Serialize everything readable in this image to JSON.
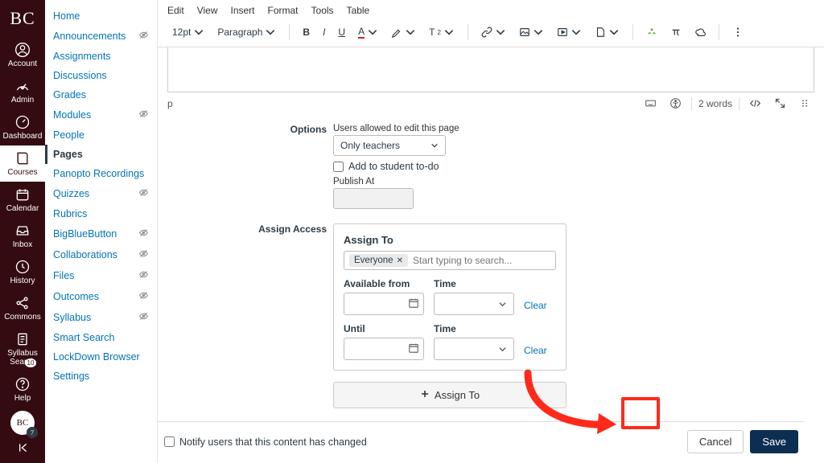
{
  "colors": {
    "brand": "#330b10",
    "primary_btn": "#0b2e52",
    "link": "#0374b5",
    "callout": "#ff2a1a"
  },
  "global_nav": {
    "logo": "BC",
    "items": [
      {
        "key": "account",
        "label": "Account",
        "icon": "user-circle-icon"
      },
      {
        "key": "admin",
        "label": "Admin",
        "icon": "speedometer-icon"
      },
      {
        "key": "dashboard",
        "label": "Dashboard",
        "icon": "gauge-icon"
      },
      {
        "key": "courses",
        "label": "Courses",
        "icon": "book-icon",
        "active": true
      },
      {
        "key": "calendar",
        "label": "Calendar",
        "icon": "calendar-icon"
      },
      {
        "key": "inbox",
        "label": "Inbox",
        "icon": "inbox-icon"
      },
      {
        "key": "history",
        "label": "History",
        "icon": "clock-icon"
      },
      {
        "key": "commons",
        "label": "Commons",
        "icon": "share-icon"
      },
      {
        "key": "syllabus",
        "label": "Syllabus Search",
        "icon": "syllabus-icon"
      },
      {
        "key": "help",
        "label": "Help",
        "icon": "help-icon",
        "badge": "10"
      }
    ],
    "avatar_text": "BC",
    "avatar_count": "7"
  },
  "course_nav": {
    "items": [
      {
        "label": "Home"
      },
      {
        "label": "Announcements",
        "hidden": true
      },
      {
        "label": "Assignments"
      },
      {
        "label": "Discussions"
      },
      {
        "label": "Grades"
      },
      {
        "label": "Modules",
        "hidden": true
      },
      {
        "label": "People"
      },
      {
        "label": "Pages",
        "active": true
      },
      {
        "label": "Panopto Recordings"
      },
      {
        "label": "Quizzes",
        "hidden": true
      },
      {
        "label": "Rubrics"
      },
      {
        "label": "BigBlueButton",
        "hidden": true
      },
      {
        "label": "Collaborations",
        "hidden": true
      },
      {
        "label": "Files",
        "hidden": true
      },
      {
        "label": "Outcomes",
        "hidden": true
      },
      {
        "label": "Syllabus",
        "hidden": true
      },
      {
        "label": "Smart Search"
      },
      {
        "label": "LockDown Browser"
      },
      {
        "label": "Settings"
      }
    ]
  },
  "editor": {
    "menus": [
      "Edit",
      "View",
      "Insert",
      "Format",
      "Tools",
      "Table"
    ],
    "font_size": "12pt",
    "block_format": "Paragraph",
    "path_display": "p",
    "word_count": "2 words"
  },
  "options": {
    "section_label": "Options",
    "editors_caption": "Users allowed to edit this page",
    "editors_value": "Only teachers",
    "todo_label": "Add to student to-do",
    "publish_label": "Publish At"
  },
  "assign": {
    "section_label": "Assign Access",
    "assign_to_heading": "Assign To",
    "token": "Everyone",
    "search_placeholder": "Start typing to search...",
    "available_from_label": "Available from",
    "until_label": "Until",
    "time_label": "Time",
    "clear": "Clear",
    "add_button": "Assign To"
  },
  "footer": {
    "notify_label": "Notify users that this content has changed",
    "cancel": "Cancel",
    "save": "Save"
  }
}
